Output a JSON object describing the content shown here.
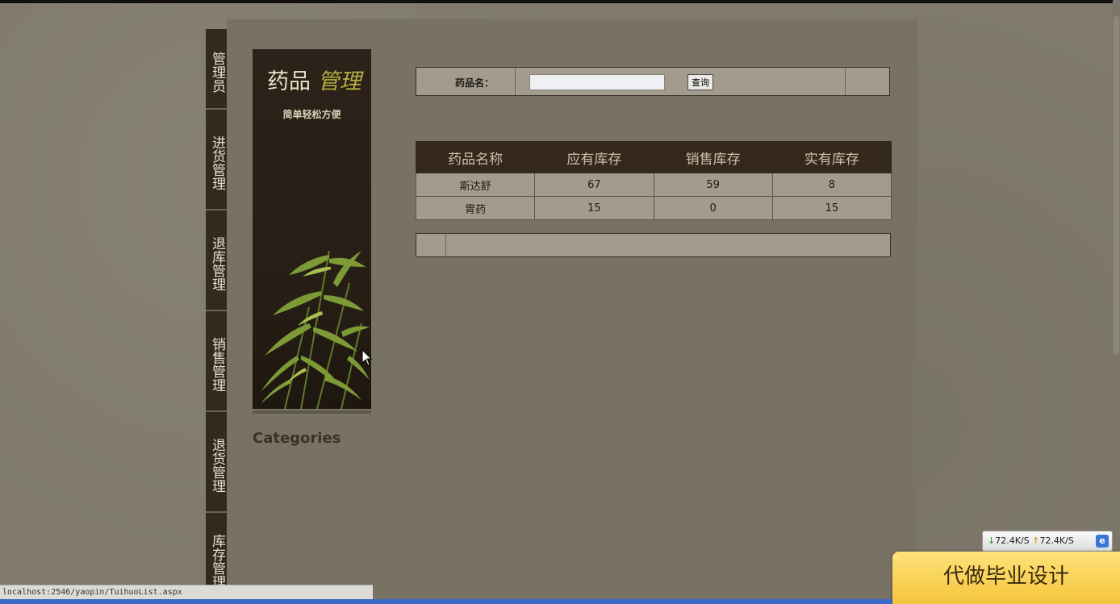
{
  "browser": {
    "status_url": "localhost:2546/yaopin/TuihuoList.aspx"
  },
  "nav": {
    "items": [
      {
        "label": "管理员"
      },
      {
        "label": "进货管理"
      },
      {
        "label": "退库管理"
      },
      {
        "label": "销售管理"
      },
      {
        "label": "退货管理"
      },
      {
        "label": "库存管理"
      }
    ]
  },
  "banner": {
    "title_main": "药品",
    "title_em": "管理",
    "subtitle": "简单轻松方便"
  },
  "sidebar": {
    "categories_heading": "Categories"
  },
  "search": {
    "label": "药品名：",
    "value": "",
    "button_label": "查询"
  },
  "table": {
    "headers": [
      "药品名称",
      "应有库存",
      "销售库存",
      "实有库存"
    ],
    "rows": [
      [
        "斯达舒",
        "67",
        "59",
        "8"
      ],
      [
        "胃药",
        "15",
        "0",
        "15"
      ]
    ]
  },
  "overlay": {
    "net_down": "72.4K/S",
    "net_up": "72.4K/S",
    "promo_text": "代做毕业设计"
  },
  "colors": {
    "page_bg": "#807a6e",
    "panel_bg": "#787264",
    "nav_bg": "#34291f",
    "table_header_bg": "#34281c",
    "cell_bg": "#a39b8e",
    "accent_title": "#b8b040"
  }
}
